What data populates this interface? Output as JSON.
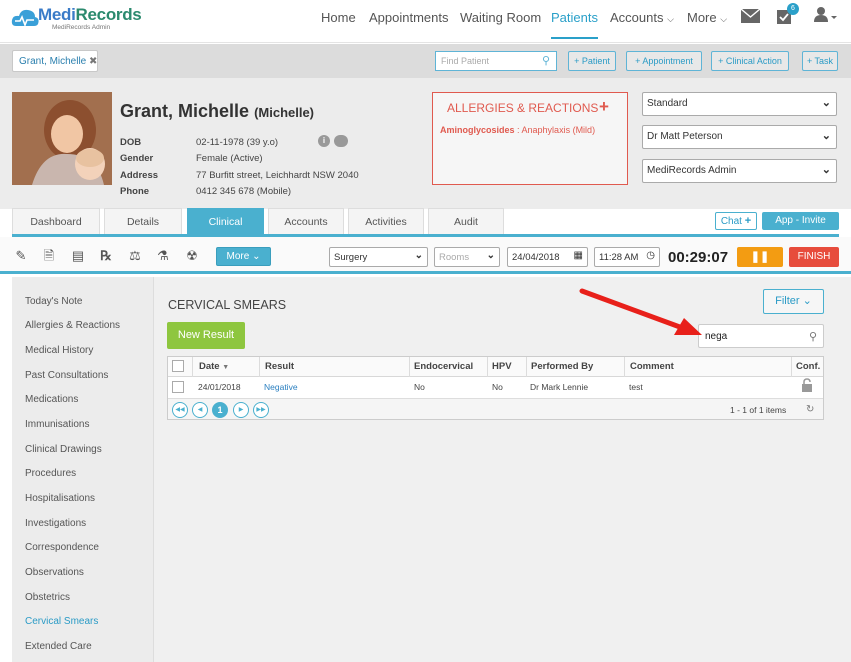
{
  "app": {
    "logo_main": "Medi",
    "logo_rest": "Records",
    "logo_sub": "MediRecords Admin"
  },
  "nav": {
    "items": [
      "Home",
      "Appointments",
      "Waiting Room",
      "Patients",
      "Accounts",
      "More"
    ],
    "badge": "6"
  },
  "subbar": {
    "patient_tab": "Grant, Michelle",
    "find_placeholder": "Find Patient",
    "buttons": [
      "+ Patient",
      "+ Appointment",
      "+ Clinical Action",
      "+ Task"
    ]
  },
  "patient": {
    "name": "Grant, Michelle",
    "preferred": "(Michelle)",
    "labels": [
      "DOB",
      "Gender",
      "Address",
      "Phone"
    ],
    "values": [
      "02-11-1978 (39 y.o)",
      "Female (Active)",
      "77 Burfitt street, Leichhardt NSW 2040",
      "0412 345 678 (Mobile)"
    ]
  },
  "allergies": {
    "title": "ALLERGIES & REACTIONS",
    "item_name": "Aminoglycosides",
    "item_reaction": " : Anaphylaxis (Mild)"
  },
  "selects": [
    "Standard",
    "Dr Matt Peterson",
    "MediRecords Admin"
  ],
  "tabs": [
    "Dashboard",
    "Details",
    "Clinical",
    "Accounts",
    "Activities",
    "Audit"
  ],
  "actions": {
    "chat": "Chat",
    "invite": "App - Invite"
  },
  "toolbar": {
    "more": "More",
    "location": "Surgery",
    "rooms": "Rooms",
    "date": "24/04/2018",
    "time": "11:28 AM",
    "timer": "00:29:07",
    "pause": "❚❚",
    "finish": "FINISH"
  },
  "sidebar": [
    "Today's Note",
    "Allergies & Reactions",
    "Medical History",
    "Past Consultations",
    "Medications",
    "Immunisations",
    "Clinical Drawings",
    "Procedures",
    "Hospitalisations",
    "Investigations",
    "Correspondence",
    "Observations",
    "Obstetrics",
    "Cervical Smears",
    "Extended Care"
  ],
  "main": {
    "title": "CERVICAL SMEARS",
    "filter": "Filter",
    "new_result": "New Result",
    "search_value": "nega"
  },
  "grid": {
    "headers": [
      "Date",
      "Result",
      "Endocervical",
      "HPV",
      "Performed By",
      "Comment",
      "Conf."
    ],
    "rows": [
      {
        "date": "24/01/2018",
        "result": "Negative",
        "endocervical": "No",
        "hpv": "No",
        "performed_by": "Dr Mark Lennie",
        "comment": "test"
      }
    ],
    "page": "1",
    "count": "1 - 1 of 1 items"
  },
  "colors": {
    "accent": "#4ab0cf",
    "allergy": "#e05a4f",
    "new_result": "#8ec63f",
    "pause": "#f39c12",
    "finish": "#e74c3c"
  }
}
